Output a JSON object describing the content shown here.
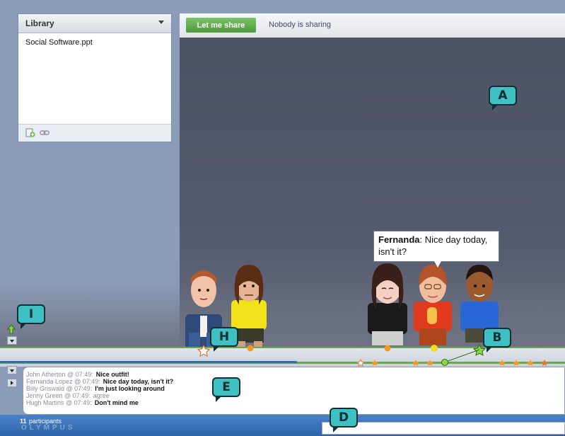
{
  "library": {
    "title": "Library",
    "files": [
      "Social Software.ppt"
    ],
    "icons": {
      "add": "add-document-icon",
      "link": "link-icon",
      "menu": "chevron-down-icon"
    }
  },
  "sharebar": {
    "share_button": "Let me share",
    "status": "Nobody is sharing"
  },
  "speech": {
    "speaker": "Fernanda",
    "text": ": Nice day today, isn't it?"
  },
  "chat": {
    "messages": [
      {
        "name": "John Atherton",
        "time": "07:49",
        "text": "Nice outfit!",
        "faint": false
      },
      {
        "name": "Fernanda Lopez",
        "time": "07:49",
        "text": "Nice day today, isn't it?",
        "faint": false
      },
      {
        "name": "Billy Griswald",
        "time": "07:49",
        "text": "I'm just looking around",
        "faint": false
      },
      {
        "name": "Jenny Green",
        "time": "07:49",
        "text": "agree",
        "faint": true
      },
      {
        "name": "Hugh Martins",
        "time": "07:49",
        "text": "Don't mind me",
        "faint": false
      }
    ]
  },
  "footer": {
    "participant_count": "11",
    "participant_label": "participants",
    "brand": "OLYMPUS"
  },
  "callouts": {
    "a": "A",
    "b": "B",
    "d": "D",
    "e": "E",
    "h": "H",
    "i": "I"
  },
  "colors": {
    "callout": "#3fc0c2",
    "share_button": "#5aa847",
    "stage": "#4f5568",
    "timeline_green": "#6aa84f",
    "timeline_blue": "#2f6fb6",
    "bottom_bar": "#3a6fb8"
  }
}
